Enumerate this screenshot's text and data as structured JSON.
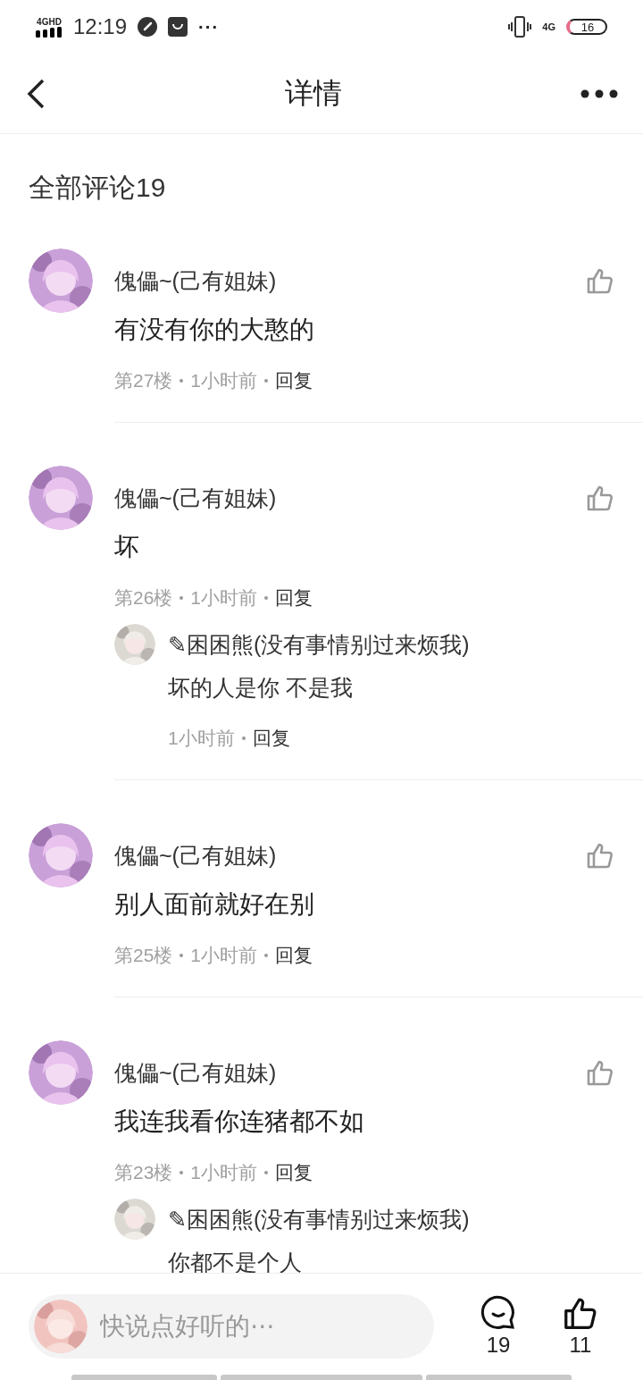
{
  "status_bar": {
    "network": "4GHD",
    "time": "12:19",
    "more": "···",
    "right_network": "4G",
    "battery": "16"
  },
  "header": {
    "title": "详情"
  },
  "comments_title": "全部评论19",
  "comments": [
    {
      "author": "傀儡~(己有姐妹)",
      "text": "有没有你的大憨的",
      "floor": "第27楼",
      "time": "1小时前",
      "reply": "回复"
    },
    {
      "author": "傀儡~(己有姐妹)",
      "text": "坏",
      "floor": "第26楼",
      "time": "1小时前",
      "reply": "回复",
      "replies": [
        {
          "author": "✎困困熊(没有事情别过来烦我)",
          "text": "坏的人是你 不是我",
          "time": "1小时前",
          "reply": "回复"
        }
      ]
    },
    {
      "author": "傀儡~(己有姐妹)",
      "text": "别人面前就好在别",
      "floor": "第25楼",
      "time": "1小时前",
      "reply": "回复"
    },
    {
      "author": "傀儡~(己有姐妹)",
      "text": "我连我看你连猪都不如",
      "floor": "第23楼",
      "time": "1小时前",
      "reply": "回复",
      "replies": [
        {
          "author": "✎困困熊(没有事情别过来烦我)",
          "text": "你都不是个人"
        }
      ]
    }
  ],
  "composer": {
    "placeholder": "快说点好听的⋯",
    "comment_count": "19",
    "like_count": "11"
  }
}
